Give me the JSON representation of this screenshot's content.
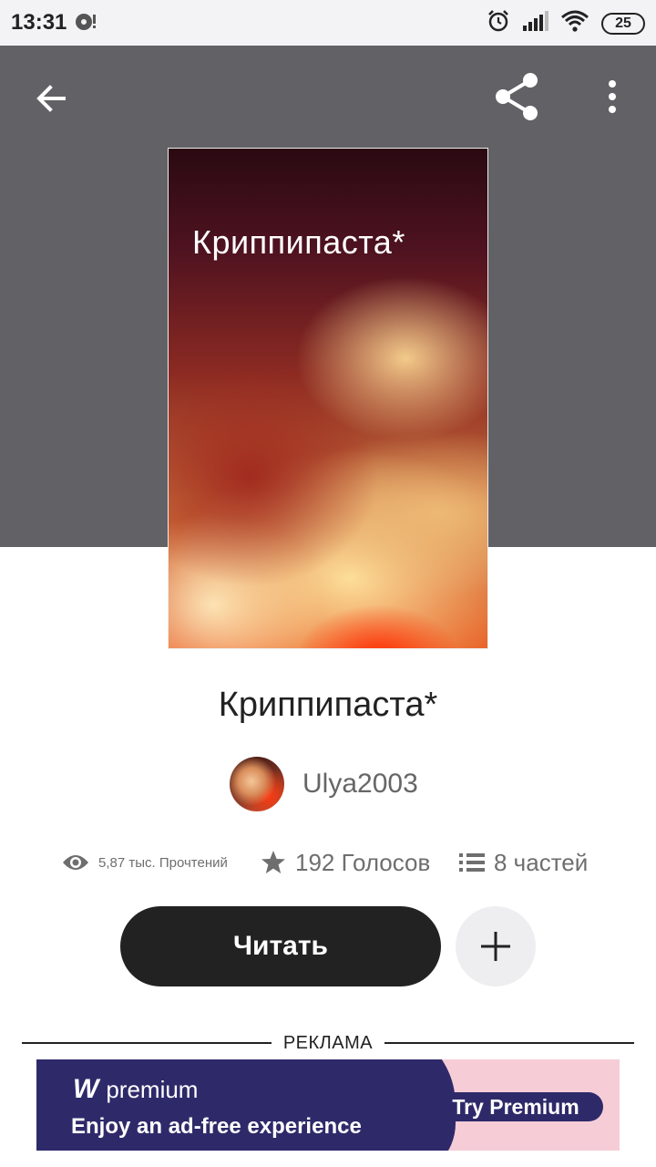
{
  "status_bar": {
    "time": "13:31",
    "battery": "25",
    "icons": [
      "notification-icon",
      "alarm-icon",
      "signal-icon",
      "wifi-icon",
      "battery-icon"
    ]
  },
  "toolbar": {
    "back_icon": "arrow-left-icon",
    "share_icon": "share-icon",
    "more_icon": "more-vertical-icon"
  },
  "story": {
    "cover_title": "Криппипаста*",
    "title": "Криппипаста*",
    "author": "Ulya2003",
    "reads": "5,87 тыс. Прочтений",
    "votes": "192 Голосов",
    "parts": "8 частей"
  },
  "actions": {
    "read_label": "Читать",
    "add_icon": "plus-icon"
  },
  "ad": {
    "label": "РЕКЛАМА",
    "brand_letter": "W",
    "brand": "premium",
    "tagline": "Enjoy an ad-free experience",
    "cta": "Try Premium"
  },
  "colors": {
    "header_bg": "#626166",
    "button_dark": "#222222",
    "ad_navy": "#2e2a6a",
    "ad_pink": "#f6cdd6"
  }
}
